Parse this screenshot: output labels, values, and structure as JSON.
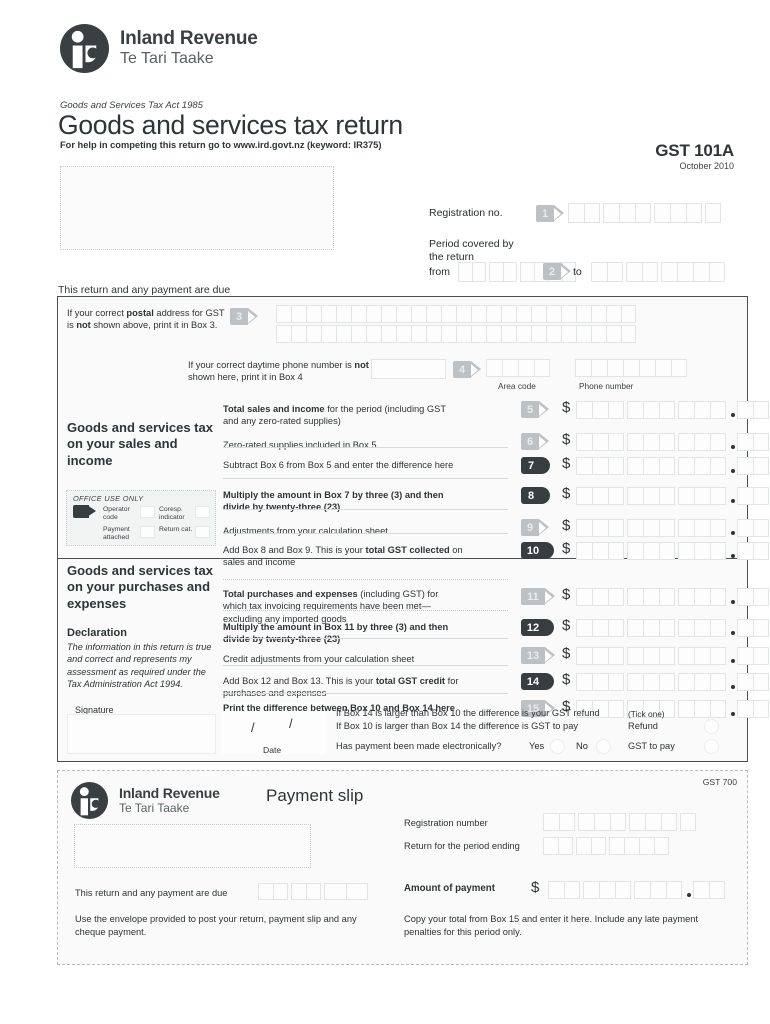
{
  "brand": {
    "name": "Inland Revenue",
    "maori": "Te Tari Taake",
    "logo_icon": "inland-revenue-koru-logo"
  },
  "header": {
    "act": "Goods and Services Tax Act 1985",
    "title": "Goods and services tax return",
    "help": "For help in competing this return go to www.ird.govt.nz (keyword: IR375)",
    "form_code": "GST 101A",
    "form_date": "October 2010"
  },
  "registration": {
    "label": "Registration no.",
    "box": "1",
    "cells": 9
  },
  "period": {
    "label_line1": "Period covered by",
    "label_line2": "the return",
    "from_label": "from",
    "to_label": "to",
    "box": "2"
  },
  "due_label": "This return and any payment are due",
  "box3": {
    "box": "3",
    "hint_a": "If your correct ",
    "hint_b": "postal",
    "hint_c": " address for GST is ",
    "hint_d": "not",
    "hint_e": " shown above, print it in Box 3."
  },
  "box4": {
    "box": "4",
    "hint_a": "If your correct daytime phone number is ",
    "hint_b": "not",
    "hint_c": " shown here, print it in Box 4",
    "area_code_label": "Area code",
    "phone_label": "Phone number"
  },
  "sections": {
    "sales_heading": "Goods and services tax on your sales and income",
    "purchases_heading": "Goods and services tax on your purchases and expenses"
  },
  "office_use": {
    "title": "OFFICE USE ONLY",
    "operator_code": "Operator code",
    "corresp_indicator": "Coresp. indicator",
    "payment_attached": "Payment attached",
    "return_cat": "Return cat."
  },
  "declaration": {
    "heading": "Declaration",
    "body": "The information in this return is true and correct and represents my assessment as required under the Tax Administration Act 1994.",
    "signature_label": "Signature",
    "date_label": "Date"
  },
  "items": [
    {
      "box": "5",
      "style": "light",
      "text_html": "<b>Total sales and income</b> for the period (including GST and any zero-rated supplies)",
      "dollar": "$"
    },
    {
      "box": "6",
      "style": "light",
      "text_html": "Zero-rated supplies included in Box 5",
      "dollar": "$"
    },
    {
      "box": "7",
      "style": "dark",
      "text_html": "Subtract Box 6 from Box 5 and enter the difference here",
      "dollar": "$"
    },
    {
      "box": "8",
      "style": "dark",
      "text_html": "<b>Multiply the amount in Box 7 by three (3) and then divide by twenty-three (23)</b>",
      "dollar": "$"
    },
    {
      "box": "9",
      "style": "light",
      "text_html": "Adjustments from your calculation sheet",
      "dollar": "$"
    },
    {
      "box": "10",
      "style": "dark",
      "text_html": "Add Box 8 and Box 9.  This is your <b>total GST collected</b> on sales and income",
      "dollar": "$"
    },
    {
      "box": "11",
      "style": "light",
      "text_html": "<b>Total purchases and expenses</b> (including GST) for which tax invoicing requirements have been met—excluding any imported goods",
      "dollar": "$"
    },
    {
      "box": "12",
      "style": "dark",
      "text_html": "<b>Multiply the amount in Box 11 by three (3) and then divide by twenty-three (23)</b>",
      "dollar": "$"
    },
    {
      "box": "13",
      "style": "light",
      "text_html": "Credit adjustments from your calculation sheet",
      "dollar": "$"
    },
    {
      "box": "14",
      "style": "dark",
      "text_html": "Add Box 12 and Box 13.  This is your <b>total GST credit</b> for purchases and expenses",
      "dollar": "$"
    },
    {
      "box": "15",
      "style": "light",
      "text_html": "<b>Print the difference between Box 10 and Box 14 here</b>",
      "dollar": "$"
    }
  ],
  "refund": {
    "line1": "If Box 14 is larger than Box 10 the difference is your GST refund",
    "line2": "If Box 10 is larger than Box 14 the difference is GST to pay",
    "electronic_question": "Has payment been made electronically?",
    "yes_label": "Yes",
    "no_label": "No",
    "tick_one": "(Tick one)",
    "refund_label": "Refund",
    "gst_to_pay_label": "GST to pay"
  },
  "payment_slip": {
    "title": "Payment slip",
    "code": "GST 700",
    "due_label": "This return and any payment are due",
    "registration_label": "Registration number",
    "period_ending_label": "Return for the period ending",
    "amount_label": "Amount of payment",
    "dollar": "$",
    "note_left": "Use the envelope provided to post your return, payment slip and any cheque payment.",
    "note_right": "Copy your total from Box 15 and enter it here.  Include any late payment penalties for this period only."
  },
  "colors": {
    "dark_marker": "#383d40",
    "light_marker": "#bdc1c3",
    "frame": "#4a4f51",
    "text": "#2f3436"
  }
}
